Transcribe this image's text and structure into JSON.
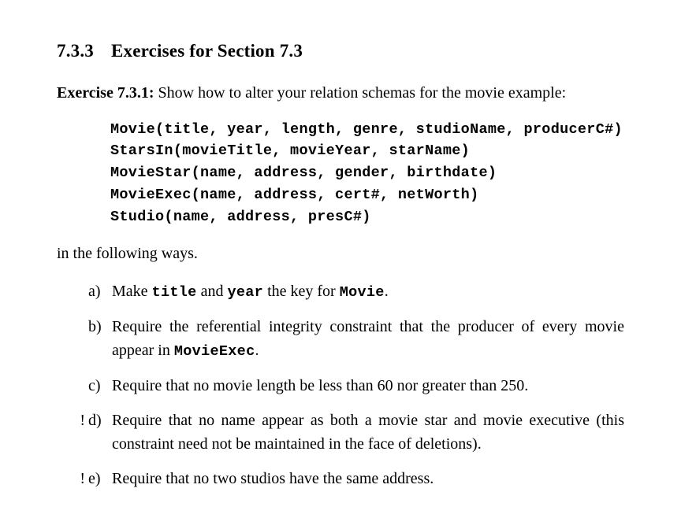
{
  "heading": {
    "number": "7.3.3",
    "title": "Exercises for Section 7.3"
  },
  "exercise_label": "Exercise 7.3.1:",
  "intro_text": " Show how to alter your relation schemas for the movie example:",
  "schemas": [
    "Movie(title, year, length, genre, studioName, producerC#)",
    "StarsIn(movieTitle, movieYear, starName)",
    "MovieStar(name, address, gender, birthdate)",
    "MovieExec(name, address, cert#, netWorth)",
    "Studio(name, address, presC#)"
  ],
  "continuation": "in the following ways.",
  "items": [
    {
      "bang": "",
      "marker": "a)",
      "parts": [
        {
          "t": "Make "
        },
        {
          "tt": "title"
        },
        {
          "t": " and "
        },
        {
          "tt": "year"
        },
        {
          "t": " the key for "
        },
        {
          "tt": "Movie"
        },
        {
          "t": "."
        }
      ]
    },
    {
      "bang": "",
      "marker": "b)",
      "parts": [
        {
          "t": "Require the referential integrity constraint that the producer of every movie appear in "
        },
        {
          "tt": "MovieExec"
        },
        {
          "t": "."
        }
      ]
    },
    {
      "bang": "",
      "marker": "c)",
      "parts": [
        {
          "t": "Require that no movie length be less than 60 nor greater than 250."
        }
      ]
    },
    {
      "bang": "!",
      "marker": "d)",
      "parts": [
        {
          "t": "Require that no name appear as both a movie star and movie executive (this constraint need not be maintained in the face of deletions)."
        }
      ]
    },
    {
      "bang": "!",
      "marker": "e)",
      "parts": [
        {
          "t": "Require that no two studios have the same address."
        }
      ]
    }
  ]
}
